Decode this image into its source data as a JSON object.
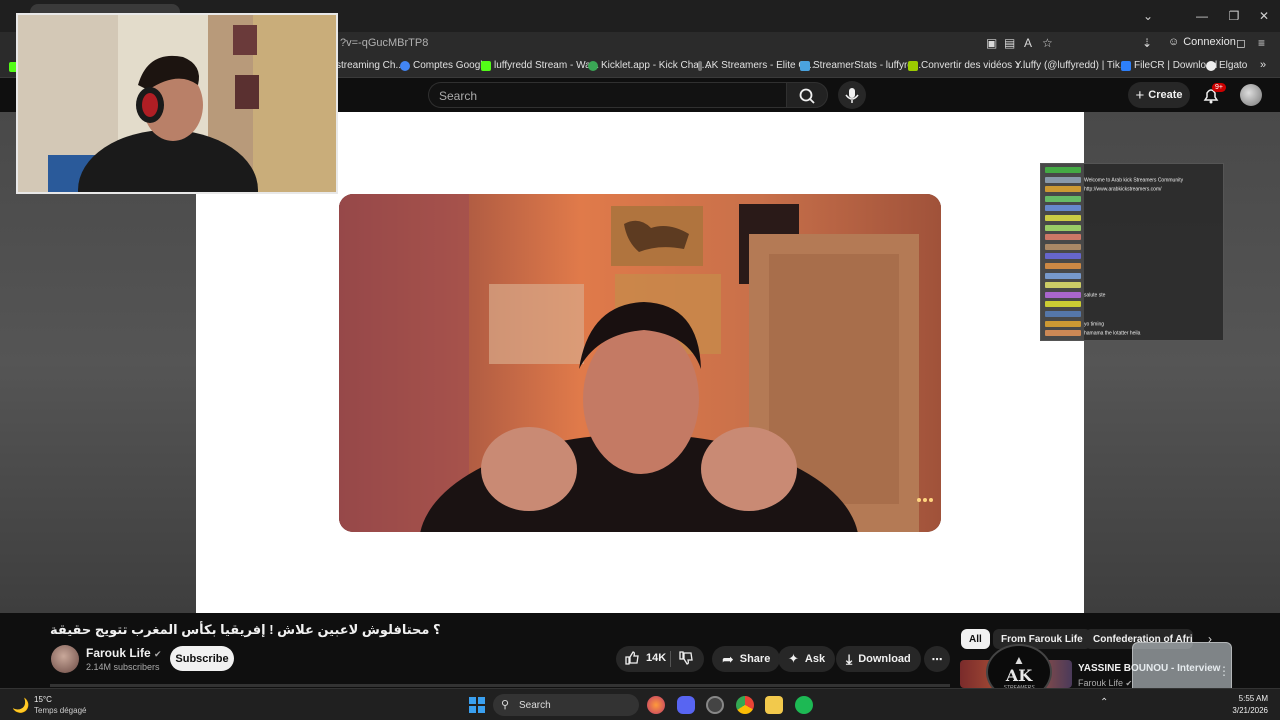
{
  "browser": {
    "url_fragment": "?v=-qGucMBrTP8",
    "connexion_label": "Connexion",
    "bookmarks": [
      {
        "label": "streaming Ch...",
        "color": "#ff8800"
      },
      {
        "label": "Comptes Google",
        "color": "#4285f4"
      },
      {
        "label": "luffyredd Stream - Wa...",
        "color": "#53fc18"
      },
      {
        "label": "Kicklet.app - Kick Chat...",
        "color": "#3aa655"
      },
      {
        "label": "AK Streamers - Elite G...",
        "color": "#777777"
      },
      {
        "label": "StreamerStats - luffyre...",
        "color": "#4aa3df"
      },
      {
        "label": "Convertir des vidéos Y...",
        "color": "#9ccc00"
      },
      {
        "label": "luffy (@luffyredd) | Tik...",
        "color": "#111111"
      },
      {
        "label": "FileCR | Download",
        "color": "#2d7ff9"
      },
      {
        "label": "Elgato",
        "color": "#222222"
      }
    ]
  },
  "youtube_header": {
    "search_placeholder": "Search",
    "create_label": "Create",
    "notification_count": "9+"
  },
  "video": {
    "title": "؟ محتافلوش لاعبين علاش ! إفريقيا بكأس المغرب تتويج حقيقة",
    "channel_name": "Farouk Life",
    "subscribers": "2.14M subscribers",
    "subscribe_label": "Subscribe",
    "like_count": "14K",
    "share_label": "Share",
    "ask_label": "Ask",
    "download_label": "Download"
  },
  "chips": [
    {
      "label": "All",
      "active": true
    },
    {
      "label": "From Farouk Life",
      "active": false
    },
    {
      "label": "Confederation of Africa",
      "active": false
    }
  ],
  "recommendation": {
    "title": "YASSINE BOUNOU - Interview",
    "channel": "Farouk Life"
  },
  "overlay_logo": {
    "text": "AK",
    "subtext": "STREAMERS"
  },
  "chat_overlay": {
    "message_welcome": "Welcome to Arab kick Streamers Community",
    "link": "http://www.arabkickstreamers.com/",
    "message_2": "salute ste",
    "message_3": "yo timing",
    "message_4": "hamama the lotatter heila",
    "name_colors": [
      "#44aa44",
      "#8899aa",
      "#cc9933",
      "#66bb66",
      "#6688cc",
      "#cccc44",
      "#99cc66",
      "#cc7766",
      "#aa8866",
      "#6666cc",
      "#cc8844",
      "#7799cc",
      "#cccc66",
      "#aa66cc",
      "#cccc33",
      "#5577aa",
      "#cc9933",
      "#cc8855"
    ]
  },
  "taskbar": {
    "temperature": "15°C",
    "weather": "Temps dégagé",
    "search_label": "Search",
    "time": "5:55 AM",
    "date": "3/21/2026"
  },
  "colors": {
    "yt_background": "#0f0f0f",
    "accent_red": "#cc0000"
  }
}
